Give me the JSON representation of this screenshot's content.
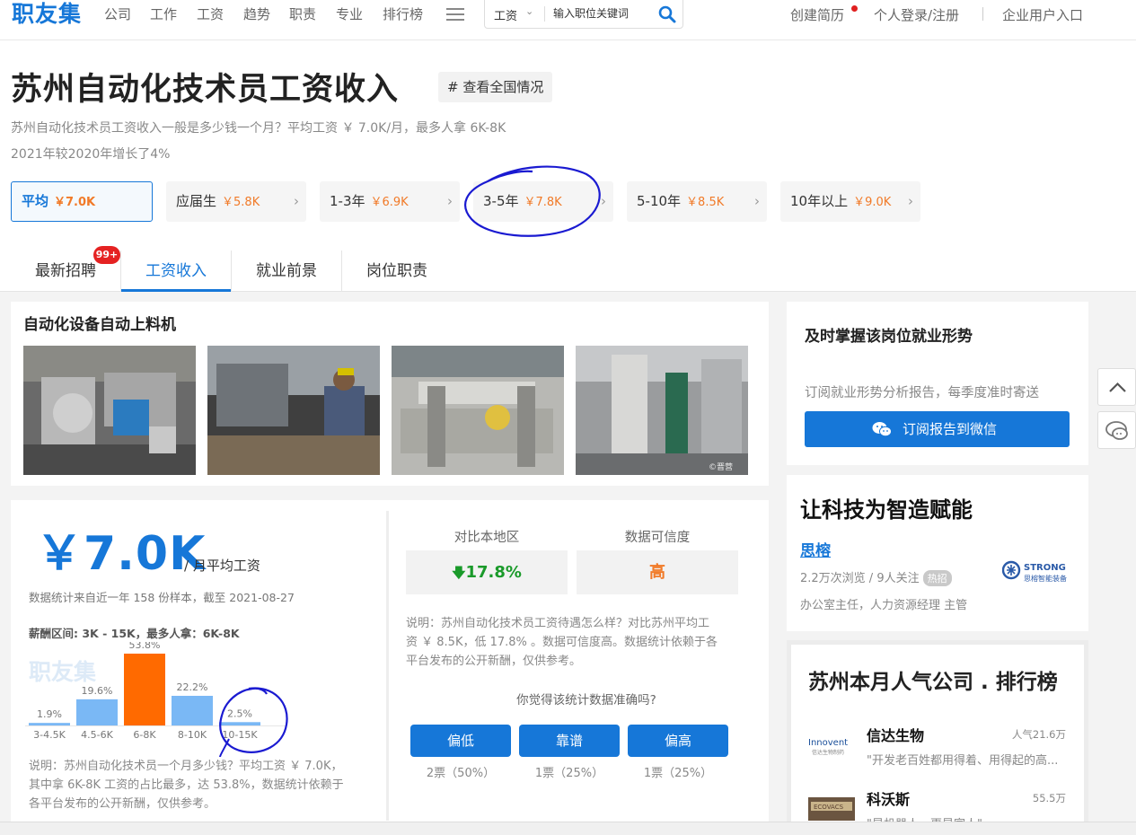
{
  "header": {
    "logo": "职友集",
    "nav": [
      "公司",
      "工作",
      "工资",
      "趋势",
      "职责",
      "专业",
      "排行榜"
    ],
    "search": {
      "type": "工资",
      "placeholder": "输入职位关键词"
    },
    "create_resume": "创建简历",
    "personal_login": "个人登录/注册",
    "enterprise_entry": "企业用户入口"
  },
  "page": {
    "title": "苏州自动化技术员工资收入",
    "nation_tag": "# 查看全国情况",
    "desc_line1": "苏州自动化技术员工资收入一般是多少钱一个月？平均工资 ￥ 7.0K/月，最多人拿 6K-8K",
    "desc_line2": "2021年较2020年增长了4%"
  },
  "experience_tabs": [
    {
      "label": "平均",
      "value": "￥7.0K"
    },
    {
      "label": "应届生",
      "value": "￥5.8K"
    },
    {
      "label": "1-3年",
      "value": "￥6.9K"
    },
    {
      "label": "3-5年",
      "value": "￥7.8K"
    },
    {
      "label": "5-10年",
      "value": "￥8.5K"
    },
    {
      "label": "10年以上",
      "value": "￥9.0K"
    }
  ],
  "tabs": {
    "items": [
      "最新招聘",
      "工资收入",
      "就业前景",
      "岗位职责"
    ],
    "active": "工资收入",
    "badge": "99+"
  },
  "gallery": {
    "title": "自动化设备自动上料机",
    "photo_caption": "©晋营"
  },
  "salary": {
    "amount": "￥7.0K",
    "unit": "/ 月平均工资",
    "sample_note": "数据统计来自近一年 158 份样本，截至 2021-08-27",
    "range_note": "薪酬区间: 3K - 15K，最多人拿：6K-8K",
    "watermark": "职友集",
    "dist_note_1": "说明：苏州自动化技术员一个月多少钱？平均工资 ￥ 7.0K，",
    "dist_note_2": "其中拿 6K-8K 工资的占比最多，达 53.8%，数据统计依赖于",
    "dist_note_3": "各平台发布的公开新酬，仅供参考。"
  },
  "chart_data": {
    "type": "bar",
    "categories": [
      "3-4.5K",
      "4.5-6K",
      "6-8K",
      "8-10K",
      "10-15K"
    ],
    "values": [
      1.9,
      19.6,
      53.8,
      22.2,
      2.5
    ],
    "value_labels": [
      "1.9%",
      "19.6%",
      "53.8%",
      "22.2%",
      "2.5%"
    ],
    "highlight_index": 2,
    "colors": {
      "normal": "#7ab8f5",
      "highlight": "#ff6a00"
    },
    "ylim": [
      0,
      53.8
    ]
  },
  "comparison": {
    "header_local": "对比本地区",
    "header_credibility": "数据可信度",
    "local_value": "17.8%",
    "credibility_value": "高",
    "note_1": "说明：苏州自动化技术员工资待遇怎么样？对比苏州平均工",
    "note_2": "资 ￥ 8.5K，低 17.8% 。数据可信度高。数据统计依赖于各",
    "note_3": "平台发布的公开新酬，仅供参考。",
    "vote_question": "你觉得该统计数据准确吗?",
    "votes": [
      {
        "label": "偏低",
        "result": "2票（50%）"
      },
      {
        "label": "靠谱",
        "result": "1票（25%）"
      },
      {
        "label": "偏高",
        "result": "1票（25%）"
      }
    ]
  },
  "subscribe": {
    "title": "及时掌握该岗位就业形势",
    "desc": "订阅就业形势分析报告，每季度准时寄送",
    "button": "订阅报告到微信"
  },
  "ad": {
    "title": "让科技为智造赋能",
    "company": "思榕",
    "stats": "2.2万次浏览 / 9人关注",
    "tag": "热招",
    "jobs": "办公室主任，人力资源经理 主管",
    "logo_text": "STRONG",
    "logo_sub": "思榕智能装备"
  },
  "ranking": {
    "title": "苏州本月人气公司 . 排行榜",
    "items": [
      {
        "name": "信达生物",
        "popularity": "人气21.6万",
        "desc": "\"开发老百姓都用得着、用得起的高...",
        "logo_text": "Innovent",
        "logo_sub": "信达生物制药"
      },
      {
        "name": "科沃斯",
        "popularity": "55.5万",
        "desc": "\"是机器人，更是家人\"",
        "logo_text": "ECOVACS"
      }
    ]
  }
}
